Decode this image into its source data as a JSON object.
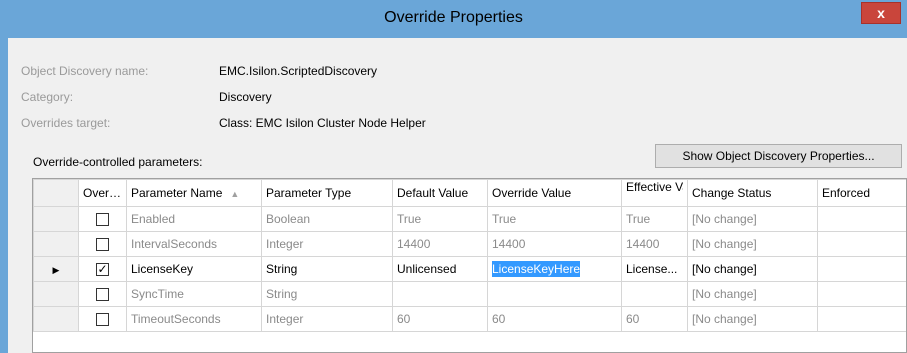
{
  "window": {
    "title": "Override Properties",
    "close_label": "x"
  },
  "info": [
    {
      "label": "Object Discovery name:",
      "value": "EMC.Isilon.ScriptedDiscovery"
    },
    {
      "label": "Category:",
      "value": "Discovery"
    },
    {
      "label": "Overrides target:",
      "value": "Class: EMC Isilon Cluster Node Helper"
    }
  ],
  "params_label": "Override-controlled parameters:",
  "show_props_button": "Show Object Discovery Properties...",
  "grid": {
    "columns": [
      "Override",
      "Parameter Name",
      "Parameter Type",
      "Default Value",
      "Override Value",
      "Effective Value",
      "Change Status",
      "Enforced"
    ],
    "sort_indicator": "▲",
    "row_indicator": "▶",
    "rows": [
      {
        "override": false,
        "name": "Enabled",
        "type": "Boolean",
        "default": "True",
        "override_value": "True",
        "effective": "True",
        "status": "[No change]"
      },
      {
        "override": false,
        "name": "IntervalSeconds",
        "type": "Integer",
        "default": "14400",
        "override_value": "14400",
        "effective": "14400",
        "status": "[No change]"
      },
      {
        "override": true,
        "name": "LicenseKey",
        "type": "String",
        "default": "Unlicensed",
        "override_value": "LicenseKeyHere",
        "effective": "License...",
        "status": "[No change]"
      },
      {
        "override": false,
        "name": "SyncTime",
        "type": "String",
        "default": "",
        "override_value": "",
        "effective": "",
        "status": "[No change]"
      },
      {
        "override": false,
        "name": "TimeoutSeconds",
        "type": "Integer",
        "default": "60",
        "override_value": "60",
        "effective": "60",
        "status": "[No change]"
      }
    ]
  },
  "colors": {
    "title_bar": "#6aa6d8",
    "close_button": "#c9453b",
    "selection": "#3399ff"
  }
}
